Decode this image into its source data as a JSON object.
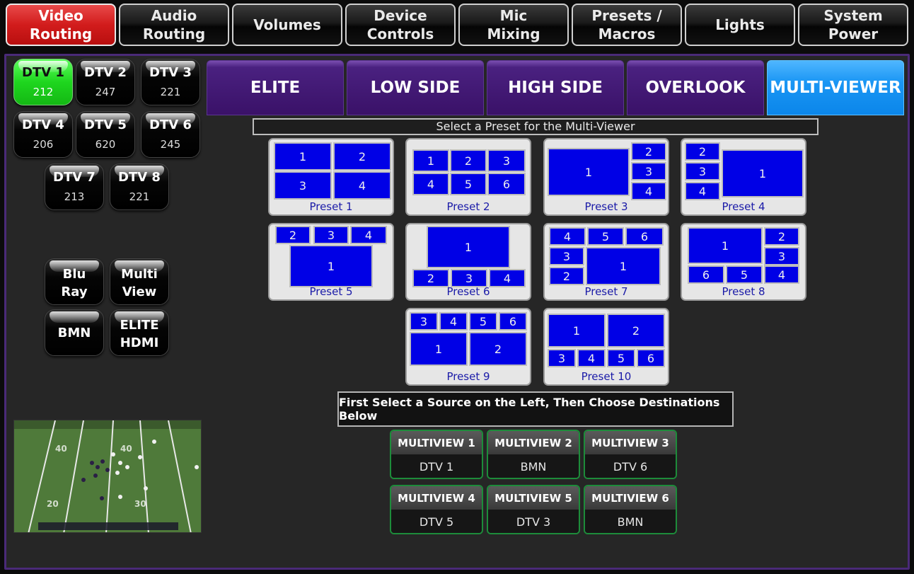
{
  "nav": [
    {
      "label": "Video\nRouting",
      "active": true
    },
    {
      "label": "Audio\nRouting",
      "active": false
    },
    {
      "label": "Volumes",
      "active": false
    },
    {
      "label": "Device\nControls",
      "active": false
    },
    {
      "label": "Mic\nMixing",
      "active": false
    },
    {
      "label": "Presets /\nMacros",
      "active": false
    },
    {
      "label": "Lights",
      "active": false
    },
    {
      "label": "System\nPower",
      "active": false
    }
  ],
  "sources": [
    {
      "name": "DTV 1",
      "channel": "212",
      "selected": true
    },
    {
      "name": "DTV 2",
      "channel": "247"
    },
    {
      "name": "DTV 3",
      "channel": "221"
    },
    {
      "name": "DTV 4",
      "channel": "206"
    },
    {
      "name": "DTV 5",
      "channel": "620"
    },
    {
      "name": "DTV 6",
      "channel": "245"
    },
    {
      "name": "DTV 7",
      "channel": "213"
    },
    {
      "name": "DTV 8",
      "channel": "221"
    }
  ],
  "other_sources": [
    {
      "name": "Blu\nRay"
    },
    {
      "name": "Multi\nView"
    },
    {
      "name": "BMN"
    },
    {
      "name": "ELITE\nHDMI"
    }
  ],
  "camera_tabs": [
    {
      "label": "ELITE",
      "active": false
    },
    {
      "label": "LOW SIDE",
      "active": false
    },
    {
      "label": "HIGH SIDE",
      "active": false
    },
    {
      "label": "OVERLOOK",
      "active": false
    },
    {
      "label": "MULTI-VIEWER",
      "active": true
    }
  ],
  "preset_instruction": "Select a Preset for the Multi-Viewer",
  "presets": [
    {
      "label": "Preset 1",
      "cells": [
        "1",
        "2",
        "3",
        "4"
      ]
    },
    {
      "label": "Preset 2",
      "cells": [
        "1",
        "2",
        "3",
        "4",
        "5",
        "6"
      ]
    },
    {
      "label": "Preset 3",
      "cells": [
        "1",
        "2",
        "3",
        "4"
      ]
    },
    {
      "label": "Preset 4",
      "cells": [
        "2",
        "3",
        "4",
        "1"
      ]
    },
    {
      "label": "Preset 5",
      "cells": [
        "2",
        "3",
        "4",
        "1"
      ]
    },
    {
      "label": "Preset 6",
      "cells": [
        "1",
        "2",
        "3",
        "4"
      ]
    },
    {
      "label": "Preset 7",
      "cells": [
        "4",
        "5",
        "6",
        "3",
        "2",
        "1"
      ]
    },
    {
      "label": "Preset 8",
      "cells": [
        "1",
        "2",
        "3",
        "6",
        "5",
        "4"
      ]
    },
    {
      "label": "Preset 9",
      "cells": [
        "3",
        "4",
        "5",
        "6",
        "1",
        "2"
      ]
    },
    {
      "label": "Preset 10",
      "cells": [
        "1",
        "2",
        "3",
        "4",
        "5",
        "6"
      ]
    }
  ],
  "route_instruction": "First Select a Source on the Left, Then Choose Destinations Below",
  "destinations": [
    {
      "title": "MULTIVIEW 1",
      "value": "DTV 1"
    },
    {
      "title": "MULTIVIEW 2",
      "value": "BMN"
    },
    {
      "title": "MULTIVIEW 3",
      "value": "DTV 6"
    },
    {
      "title": "MULTIVIEW 4",
      "value": "DTV 5"
    },
    {
      "title": "MULTIVIEW 5",
      "value": "DTV 3"
    },
    {
      "title": "MULTIVIEW 6",
      "value": "BMN"
    }
  ],
  "colors": {
    "active_nav": "#d21c1c",
    "camera_tab": "#3a1168",
    "active_camera_tab": "#1a96f4",
    "selected_source": "#1ed61e",
    "preset_cell": "#0000e6",
    "destination_border": "#1d8c3a"
  }
}
